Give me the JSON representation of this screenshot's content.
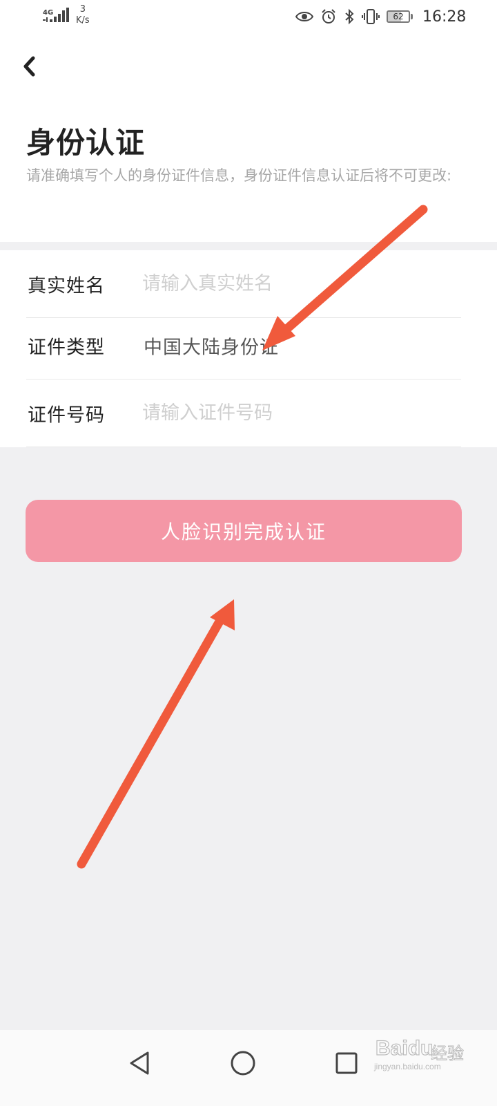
{
  "status_bar": {
    "network": "4G",
    "speed_value": "3",
    "speed_unit": "K/s",
    "battery_level": "62",
    "time": "16:28",
    "icons": [
      "signal-icon",
      "eye-icon",
      "alarm-icon",
      "bluetooth-icon",
      "vibrate-icon",
      "battery-icon"
    ]
  },
  "header": {
    "title": "身份认证",
    "subtitle": "请准确填写个人的身份证件信息，身份证件信息认证后将不可更改:"
  },
  "form": {
    "name": {
      "label": "真实姓名",
      "value": "",
      "placeholder": "请输入真实姓名"
    },
    "id_type": {
      "label": "证件类型",
      "value": "中国大陆身份证"
    },
    "id_number": {
      "label": "证件号码",
      "value": "",
      "placeholder": "请输入证件号码"
    }
  },
  "submit": {
    "label": "人脸识别完成认证"
  },
  "nav": {
    "icons": [
      "back-triangle-icon",
      "home-circle-icon",
      "recents-square-icon"
    ]
  },
  "watermark": {
    "brand": "Bai",
    "brand_suffix": "du",
    "product": "经验",
    "url": "jingyan.baidu.com"
  },
  "colors": {
    "accent_button": "#f497a6",
    "annotation_arrow": "#f05a3c",
    "page_background": "#f0f0f2"
  }
}
